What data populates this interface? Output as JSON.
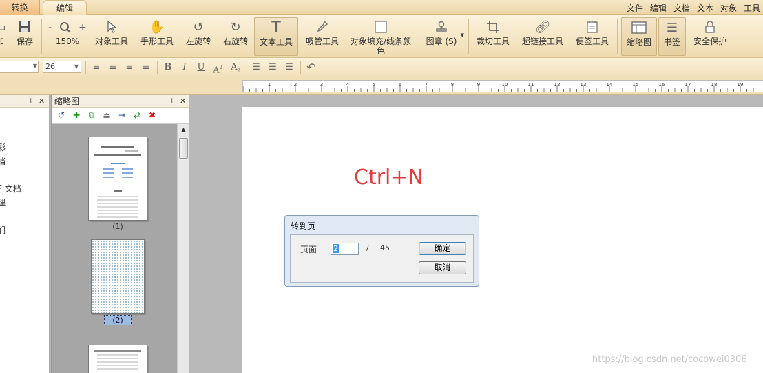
{
  "tabs": [
    "转换",
    "编辑"
  ],
  "menu": [
    "文件",
    "编辑",
    "文档",
    "文本",
    "对象",
    "工具"
  ],
  "ribbon": {
    "partial_label": "加",
    "save": "保存",
    "zoom_minus": "-",
    "zoom_plus": "+",
    "zoom_value": "150%",
    "object_tool": "对象工具",
    "hand_tool": "手形工具",
    "rotate_left": "左旋转",
    "rotate_right": "右旋转",
    "text_tool": "文本工具",
    "eyedropper": "吸管工具",
    "fill_stroke_line1": "对象填充/线条颜",
    "fill_stroke_line2": "色",
    "stamp": "图章 (S)",
    "crop": "裁切工具",
    "link": "超链接工具",
    "note": "便签工具",
    "thumbnails": "缩略图",
    "bookmarks": "书签",
    "security": "安全保护"
  },
  "format": {
    "font_name": "",
    "font_size": "26"
  },
  "left_panel": {
    "fragments": [
      "彩",
      "档",
      "F 文档",
      "理",
      "们"
    ]
  },
  "thumbnail_panel": {
    "title": "缩略图",
    "labels": [
      "(1)",
      "(2)"
    ]
  },
  "canvas": {
    "annotation": "Ctrl+N"
  },
  "dialog": {
    "title": "转到页",
    "page_label": "页面",
    "page_input": "2",
    "separator": "/",
    "total": "45",
    "ok": "确定",
    "cancel": "取消"
  },
  "watermark": "https://blog.csdn.net/cocowei0306",
  "colors": {
    "annotation_red": "#e53b3b",
    "ribbon_bg": "#f0dcb1",
    "dialog_border": "#7f9db9"
  }
}
